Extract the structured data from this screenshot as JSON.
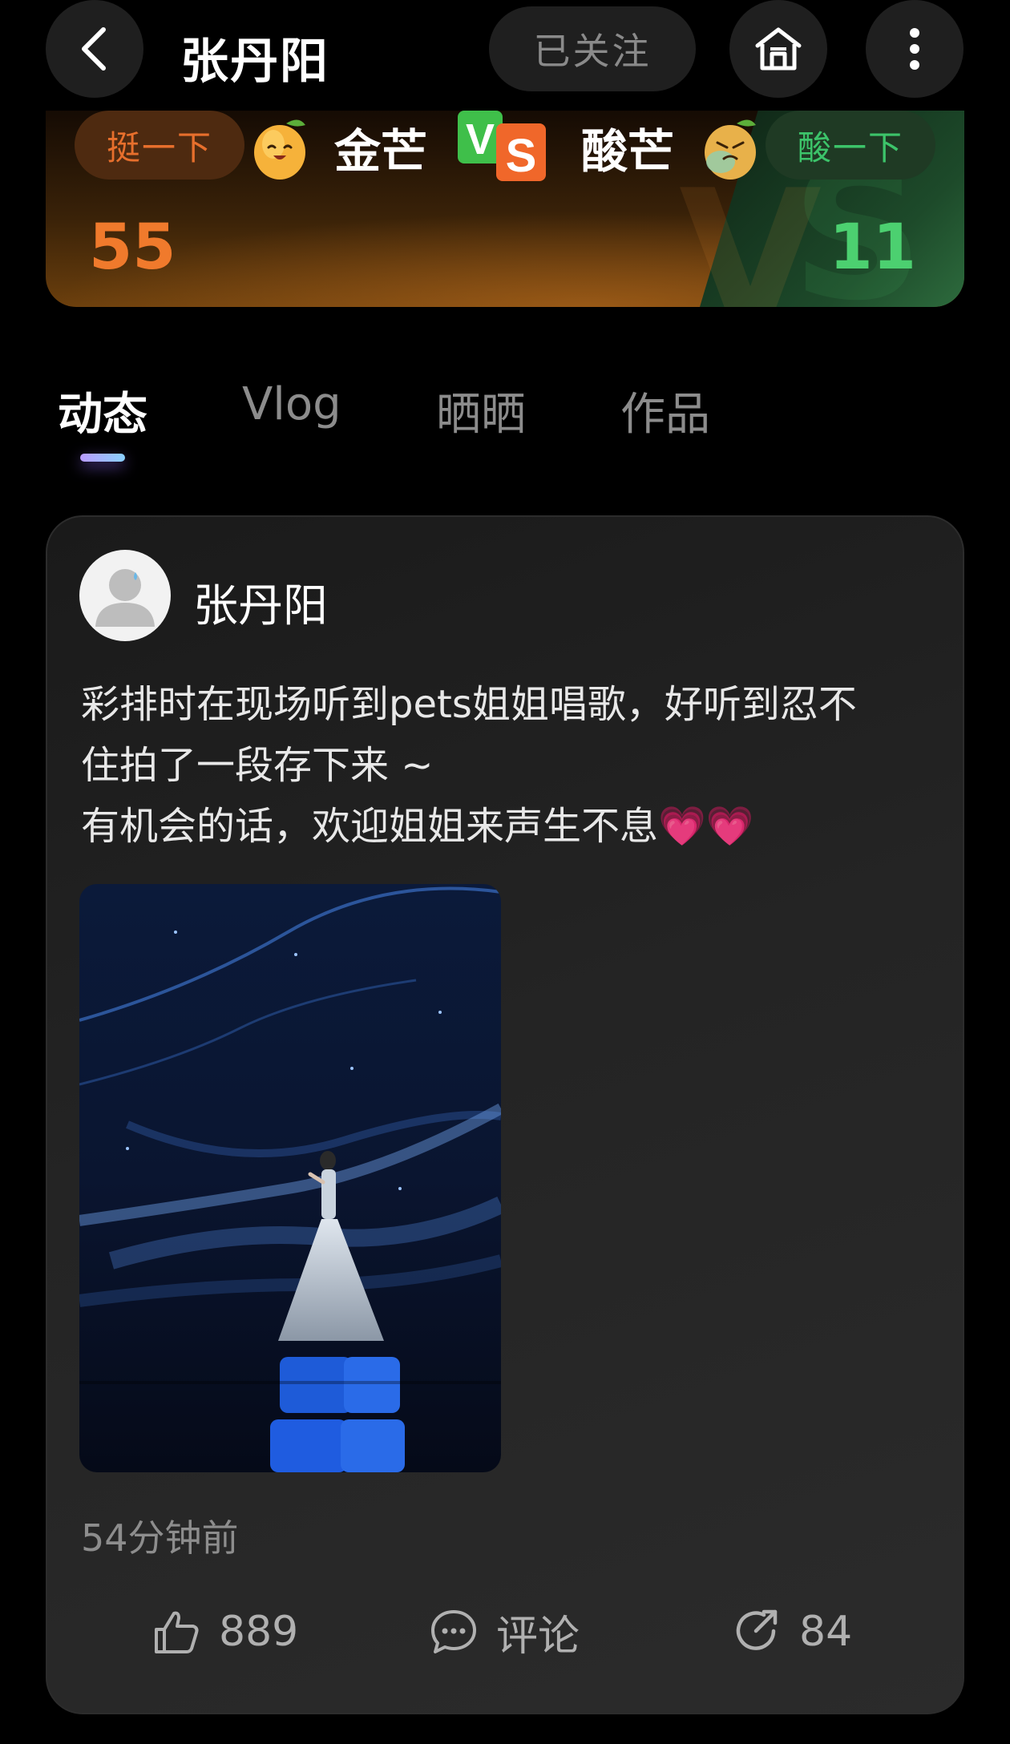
{
  "header": {
    "title": "张丹阳",
    "follow_label": "已关注",
    "back_icon": "chevron-left-icon",
    "home_icon": "home-icon",
    "more_icon": "more-vertical-icon"
  },
  "vs_banner": {
    "left_button": "挺一下",
    "left_team": "金芒",
    "left_score": "55",
    "right_team": "酸芒",
    "right_button": "酸一下",
    "right_score": "11",
    "vs_icon": "vs-badge-icon",
    "left_color": "#f07a2c",
    "right_color": "#4cd070"
  },
  "tabs": [
    {
      "label": "动态",
      "active": true
    },
    {
      "label": "Vlog",
      "active": false
    },
    {
      "label": "晒晒",
      "active": false
    },
    {
      "label": "作品",
      "active": false
    }
  ],
  "post": {
    "author": "张丹阳",
    "text_lines": [
      "彩排时在现场听到pets姐姐唱歌，好听到忍不",
      "住拍了一段存下来 ~",
      "有机会的话，欢迎姐姐来声生不息"
    ],
    "hearts": "💗💗",
    "timestamp": "54分钟前",
    "likes": "889",
    "comment_label": "评论",
    "shares": "84"
  }
}
